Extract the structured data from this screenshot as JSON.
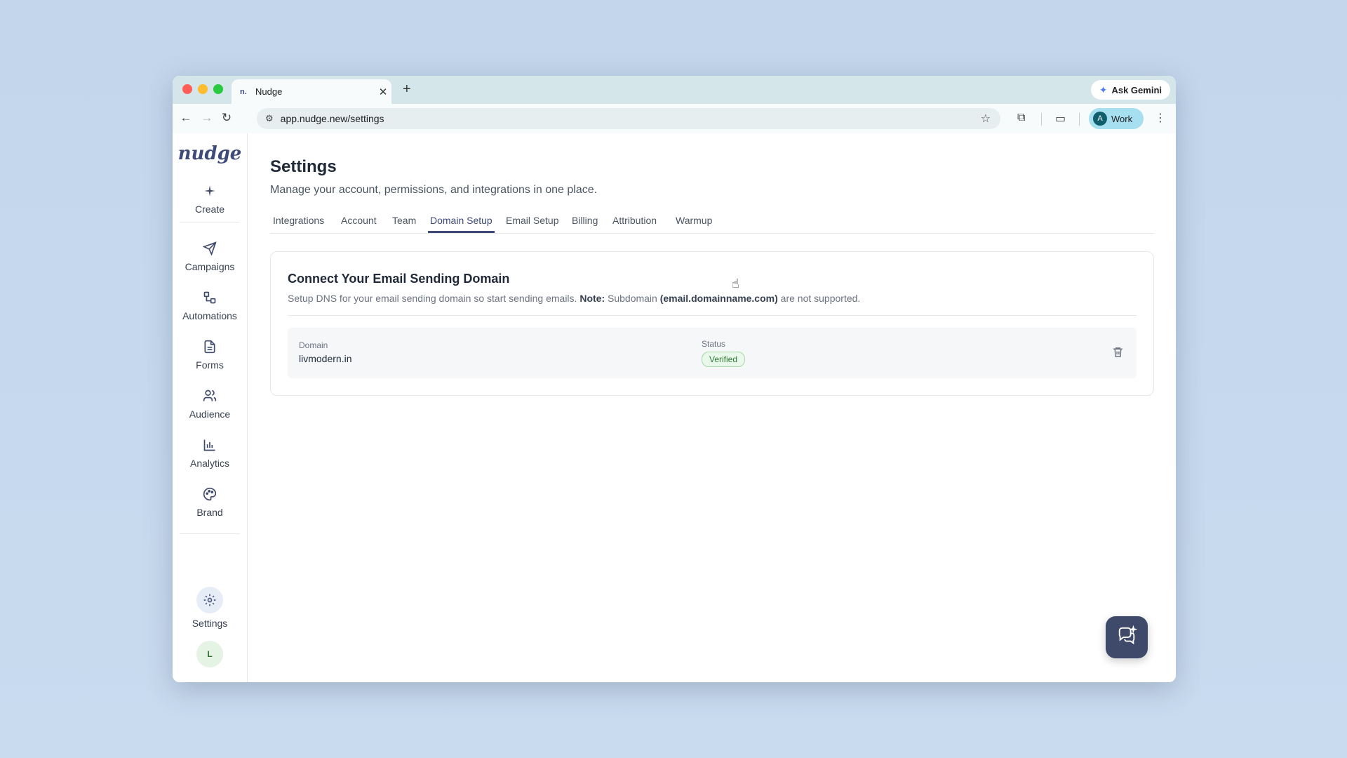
{
  "browser": {
    "tab_title": "Nudge",
    "tab_favicon": "n.",
    "new_tab_label": "+",
    "ask_gemini": "Ask Gemini",
    "url": "app.nudge.new/settings",
    "profile_initial": "A",
    "profile_name": "Work"
  },
  "sidebar": {
    "logo": "nudge",
    "items": [
      {
        "label": "Create",
        "icon": "plus-icon"
      },
      {
        "label": "Campaigns",
        "icon": "send-icon"
      },
      {
        "label": "Automations",
        "icon": "shapes-icon"
      },
      {
        "label": "Forms",
        "icon": "document-icon"
      },
      {
        "label": "Audience",
        "icon": "users-icon"
      },
      {
        "label": "Analytics",
        "icon": "bar-chart-icon"
      },
      {
        "label": "Brand",
        "icon": "palette-icon"
      }
    ],
    "settings_label": "Settings",
    "user_initial": "L"
  },
  "page": {
    "title": "Settings",
    "subtitle": "Manage your account, permissions, and integrations in one place.",
    "tabs": [
      "Integrations",
      "Account",
      "Team",
      "Domain Setup",
      "Email Setup",
      "Billing",
      "Attribution",
      "Warmup"
    ],
    "active_tab": "Domain Setup"
  },
  "card": {
    "title": "Connect Your Email Sending Domain",
    "desc_prefix": "Setup DNS for your email sending domain so start sending emails.",
    "note_label": "Note:",
    "desc_mid": "Subdomain",
    "desc_example": "(email.domainname.com)",
    "desc_suffix": "are not supported.",
    "domain_label": "Domain",
    "domain_value": "livmodern.in",
    "status_label": "Status",
    "status_value": "Verified"
  },
  "colors": {
    "accent": "#3d4a7a",
    "verified_green": "#2f7a35",
    "background": "#c3d6ec"
  }
}
